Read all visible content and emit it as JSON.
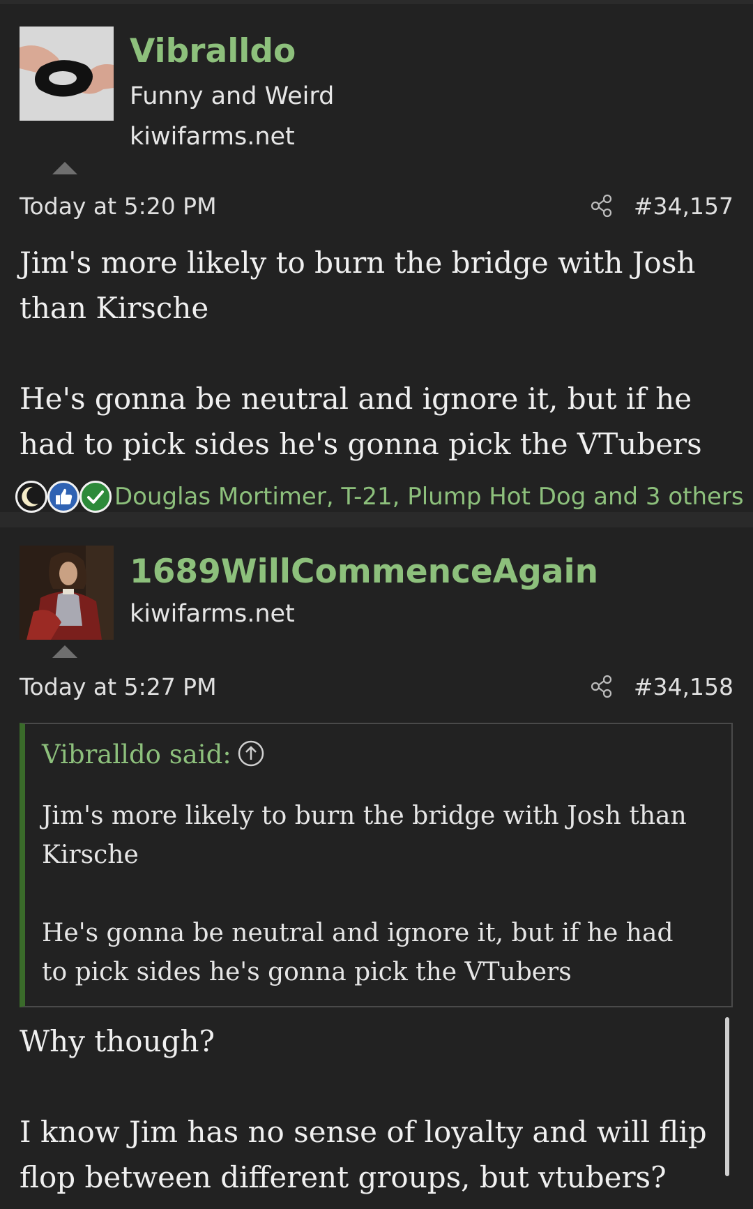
{
  "posts": [
    {
      "username": "Vibralldo",
      "user_title": "Funny and Weird",
      "site": "kiwifarms.net",
      "timestamp": "Today at 5:20 PM",
      "post_number": "#34,157",
      "paragraphs": [
        "Jim's more likely to burn the bridge with Josh than Kirsche",
        "He's gonna be neutral and ignore it, but if he had to pick sides he's gonna pick the VTubers"
      ],
      "reactions": {
        "icons": [
          "moon-reaction-icon",
          "thumbs-up-reaction-icon",
          "checkmark-reaction-icon"
        ],
        "text": "Douglas Mortimer, T-21, Plump Hot Dog and 3 others"
      }
    },
    {
      "username": "1689WillCommenceAgain",
      "site": "kiwifarms.net",
      "timestamp": "Today at 5:27 PM",
      "post_number": "#34,158",
      "quote": {
        "header": "Vibralldo said:",
        "paragraphs": [
          "Jim's more likely to burn the bridge with Josh than Kirsche",
          "He's gonna be neutral and ignore it, but if he had to pick sides he's gonna pick the VTubers"
        ]
      },
      "paragraphs": [
        "Why though?",
        "I know Jim has no sense of loyalty and will flip flop between different groups, but vtubers?"
      ]
    }
  ],
  "colors": {
    "background": "#1e1e1e",
    "post_background": "#222222",
    "username": "#8dc07c",
    "quote_border": "#3a6b2a",
    "text": "#f0f0f0"
  }
}
